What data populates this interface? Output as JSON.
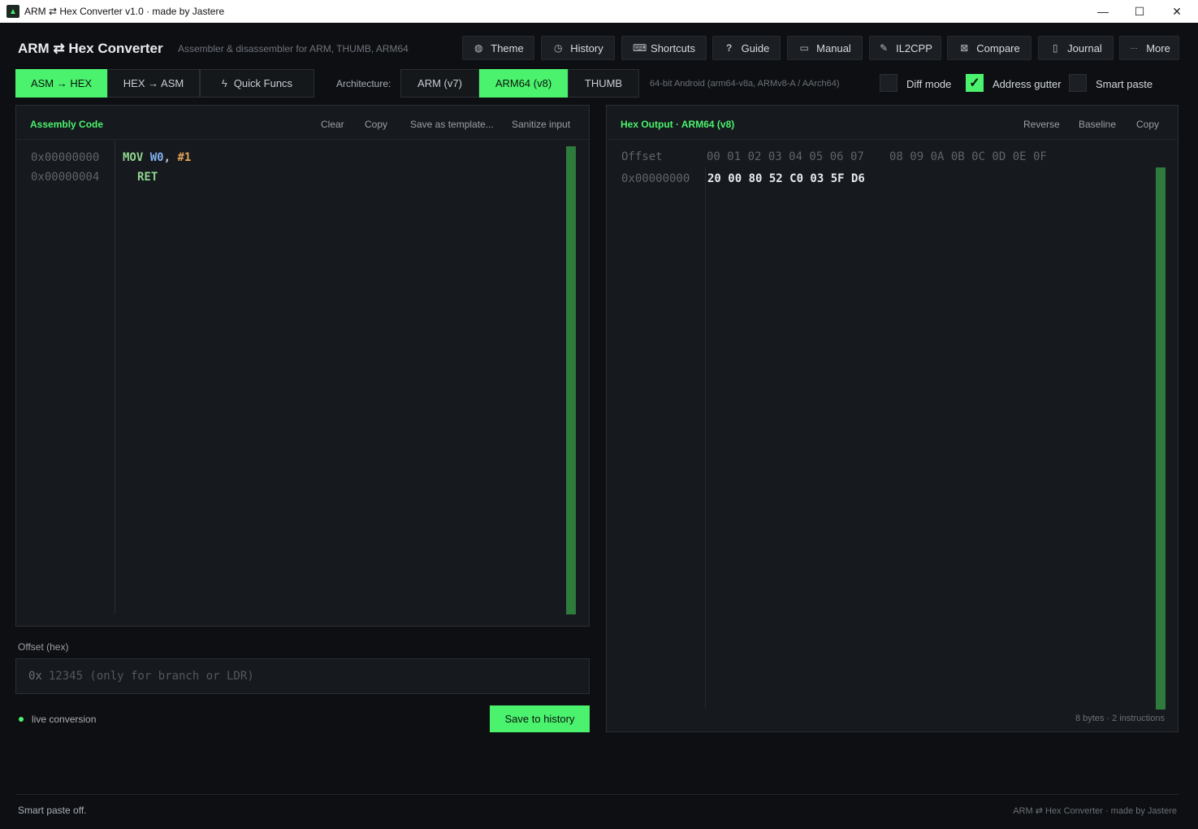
{
  "window": {
    "title": "ARM ⇄ Hex Converter v1.0  ·  made by Jastere",
    "minimize": "—",
    "maximize": "☐",
    "close": "✕"
  },
  "header": {
    "app_name": "ARM ⇄ Hex Converter",
    "subtitle": "Assembler & disassembler for ARM, THUMB, ARM64",
    "buttons": [
      {
        "label": "Theme",
        "icon": "palette-icon",
        "glyph": "◍"
      },
      {
        "label": "History",
        "icon": "clock-icon",
        "glyph": "◷"
      },
      {
        "label": "Shortcuts",
        "icon": "keyboard-icon",
        "glyph": "⌨"
      },
      {
        "label": "Guide",
        "icon": "question-icon",
        "glyph": "?"
      },
      {
        "label": "Manual",
        "icon": "book-icon",
        "glyph": "▭"
      },
      {
        "label": "IL2CPP",
        "icon": "pin-icon",
        "glyph": "✎"
      },
      {
        "label": "Compare",
        "icon": "compare-icon",
        "glyph": "⊠"
      },
      {
        "label": "Journal",
        "icon": "journal-icon",
        "glyph": "▯"
      },
      {
        "label": "More",
        "icon": "more-icon",
        "glyph": "···"
      }
    ]
  },
  "modes": {
    "tabs": [
      {
        "label": "ASM → HEX",
        "active": true
      },
      {
        "label": "HEX → ASM",
        "active": false
      },
      {
        "label": "Quick Funcs",
        "active": false,
        "glyph": "ϟ"
      }
    ]
  },
  "architecture": {
    "label": "Architecture:",
    "tabs": [
      {
        "label": "ARM (v7)",
        "active": false
      },
      {
        "label": "ARM64 (v8)",
        "active": true
      },
      {
        "label": "THUMB",
        "active": false
      }
    ],
    "description": "64-bit Android  (arm64-v8a, ARMv8-A / AArch64)"
  },
  "options": {
    "diff_mode": {
      "label": "Diff mode",
      "checked": false
    },
    "address_gutter": {
      "label": "Address gutter",
      "checked": true,
      "mark": "✓"
    },
    "smart_paste": {
      "label": "Smart paste",
      "checked": false
    }
  },
  "assembly_panel": {
    "title": "Assembly Code",
    "actions": [
      "Clear",
      "Copy",
      "Save as template...",
      "Sanitize input"
    ],
    "lines": [
      {
        "address": "0x00000000",
        "mnemonic": "MOV",
        "reg": "W0",
        "sep": ",",
        "imm": "#1"
      },
      {
        "address": "0x00000004",
        "mnemonic": "RET"
      }
    ]
  },
  "offset": {
    "label": "Offset (hex)",
    "prefix": "0x",
    "placeholder": "12345  (only for branch or LDR)"
  },
  "live": {
    "label": "live conversion"
  },
  "save_button": {
    "label": "Save to history"
  },
  "hex_panel": {
    "title": "Hex Output  ·  ARM64 (v8)",
    "actions": [
      "Reverse",
      "Baseline",
      "Copy"
    ],
    "header_offset": "Offset",
    "header_cols_a": "00 01 02 03 04 05 06 07",
    "header_cols_b": "08 09 0A 0B 0C 0D 0E 0F",
    "rows": [
      {
        "offset": "0x00000000",
        "bytes": "20 00 80 52 C0 03 5F D6"
      }
    ],
    "stats": "8 bytes  ·  2 instructions"
  },
  "status": {
    "message": "Smart paste off.",
    "credit": "ARM ⇄ Hex Converter  ·  made by Jastere"
  },
  "colors": {
    "accent": "#4bf26e",
    "background": "#0d0f12",
    "panel": "#16191d"
  }
}
